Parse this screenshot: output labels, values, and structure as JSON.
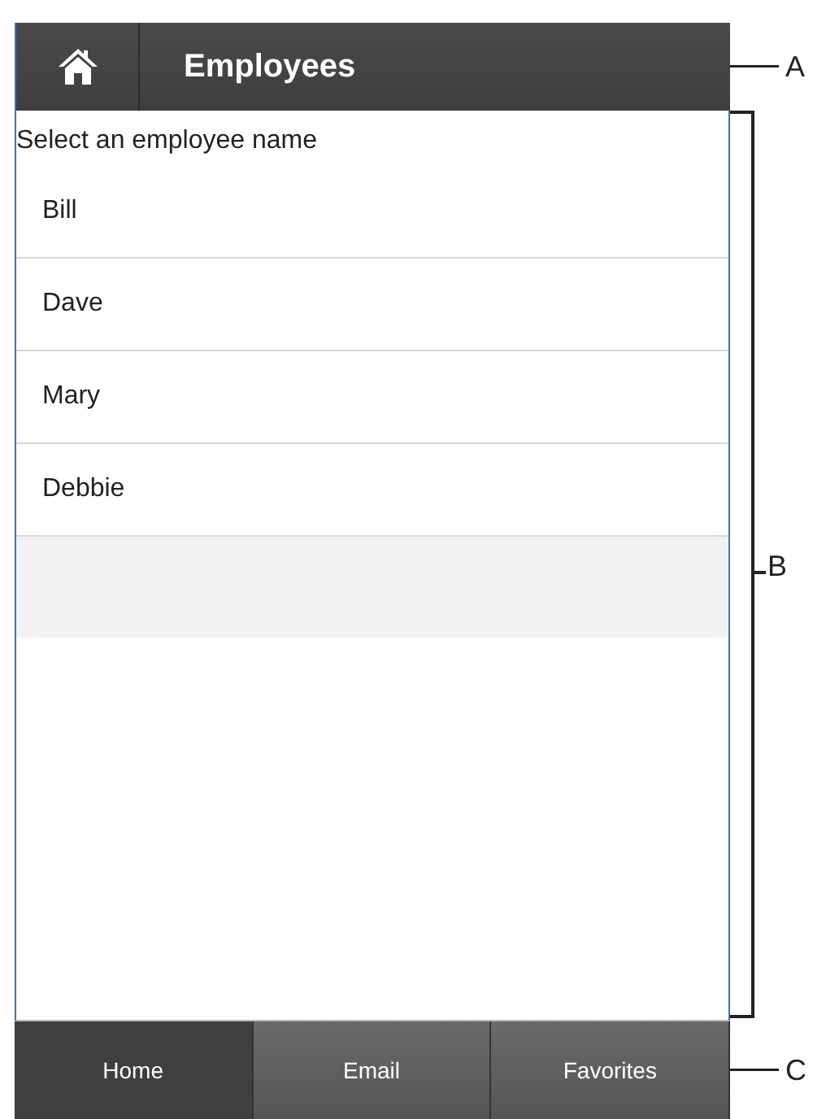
{
  "header": {
    "title": "Employees"
  },
  "prompt": "Select an employee name",
  "employees": [
    {
      "name": "Bill"
    },
    {
      "name": "Dave"
    },
    {
      "name": "Mary"
    },
    {
      "name": "Debbie"
    }
  ],
  "tabs": [
    {
      "label": "Home",
      "selected": true
    },
    {
      "label": "Email",
      "selected": false
    },
    {
      "label": "Favorites",
      "selected": false
    }
  ],
  "callouts": [
    "A",
    "B",
    "C"
  ]
}
